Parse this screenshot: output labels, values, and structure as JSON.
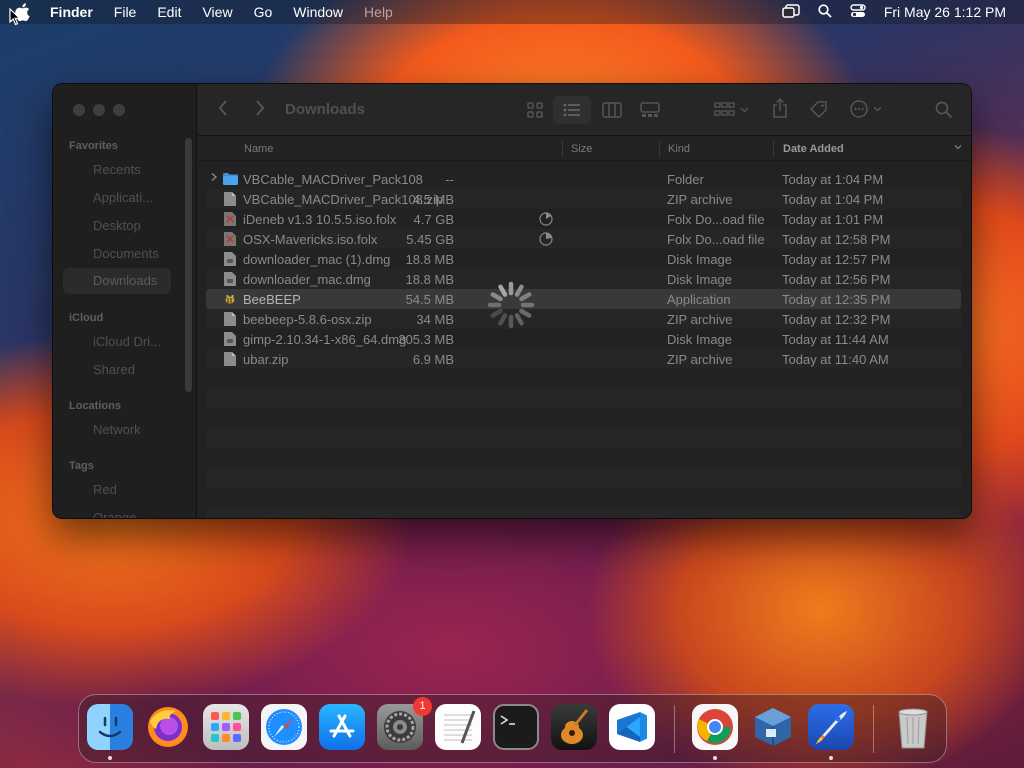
{
  "menubar": {
    "app_name": "Finder",
    "menus": [
      "File",
      "Edit",
      "View",
      "Go",
      "Window",
      "Help"
    ],
    "clock": "Fri May 26  1:12 PM"
  },
  "finder": {
    "title": "Downloads",
    "sidebar": {
      "favorites_header": "Favorites",
      "favorites": [
        "Recents",
        "Applicati...",
        "Desktop",
        "Documents",
        "Downloads"
      ],
      "icloud_header": "iCloud",
      "icloud": [
        "iCloud Dri...",
        "Shared"
      ],
      "locations_header": "Locations",
      "locations": [
        "Network"
      ],
      "tags_header": "Tags",
      "tags": [
        "Red",
        "Orange"
      ]
    },
    "columns": {
      "name": "Name",
      "size": "Size",
      "kind": "Kind",
      "date_added": "Date Added"
    },
    "files": [
      {
        "name": "VBCable_MACDriver_Pack108",
        "size": "--",
        "kind": "Folder",
        "date": "Today at 1:04 PM",
        "icon": "folder-icon"
      },
      {
        "name": "VBCable_MACDriver_Pack108.zip",
        "size": "4.5 MB",
        "kind": "ZIP archive",
        "date": "Today at 1:04 PM",
        "icon": "zip-icon"
      },
      {
        "name": "iDeneb v1.3 10.5.5.iso.folx",
        "size": "4.7 GB",
        "kind": "Folx Do...oad file",
        "date": "Today at 1:01 PM",
        "icon": "folx-icon"
      },
      {
        "name": "OSX-Mavericks.iso.folx",
        "size": "5.45 GB",
        "kind": "Folx Do...oad file",
        "date": "Today at 12:58 PM",
        "icon": "folx-icon"
      },
      {
        "name": "downloader_mac (1).dmg",
        "size": "18.8 MB",
        "kind": "Disk Image",
        "date": "Today at 12:57 PM",
        "icon": "dmg-icon"
      },
      {
        "name": "downloader_mac.dmg",
        "size": "18.8 MB",
        "kind": "Disk Image",
        "date": "Today at 12:56 PM",
        "icon": "dmg-icon"
      },
      {
        "name": "BeeBEEP",
        "size": "54.5 MB",
        "kind": "Application",
        "date": "Today at 12:35 PM",
        "icon": "bee-icon"
      },
      {
        "name": "beebeep-5.8.6-osx.zip",
        "size": "34 MB",
        "kind": "ZIP archive",
        "date": "Today at 12:32 PM",
        "icon": "zip-icon"
      },
      {
        "name": "gimp-2.10.34-1-x86_64.dmg",
        "size": "305.3 MB",
        "kind": "Disk Image",
        "date": "Today at 11:44 AM",
        "icon": "dmg-icon"
      },
      {
        "name": "ubar.zip",
        "size": "6.9 MB",
        "kind": "ZIP archive",
        "date": "Today at 11:40 AM",
        "icon": "zip-icon"
      }
    ]
  },
  "dock": {
    "apps": [
      "finder",
      "firefox",
      "launchpad",
      "safari",
      "app-store",
      "system-settings",
      "textedit",
      "terminal",
      "garageband",
      "vscode",
      "chrome",
      "virtualbox",
      "rocket",
      "trash"
    ],
    "settings_badge": "1"
  }
}
